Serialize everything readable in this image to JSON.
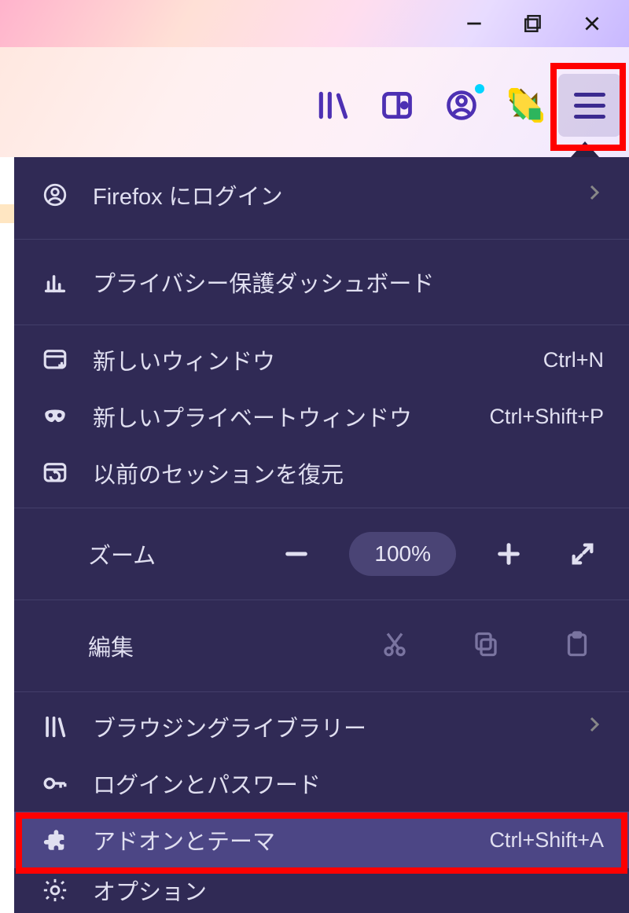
{
  "window_controls": {
    "minimize": "minimize",
    "maximize": "maximize",
    "close": "close"
  },
  "toolbar": {
    "library": "library-icon",
    "sidebar": "sidebar-icon",
    "account": "account-icon",
    "download": "download-icon",
    "menu": "menu-icon"
  },
  "menu": {
    "login": {
      "label": "Firefox にログイン"
    },
    "privacy_dashboard": {
      "label": "プライバシー保護ダッシュボード"
    },
    "new_window": {
      "label": "新しいウィンドウ",
      "shortcut": "Ctrl+N"
    },
    "new_private_window": {
      "label": "新しいプライベートウィンドウ",
      "shortcut": "Ctrl+Shift+P"
    },
    "restore_session": {
      "label": "以前のセッションを復元"
    },
    "zoom": {
      "label": "ズーム",
      "value": "100%"
    },
    "edit": {
      "label": "編集"
    },
    "library": {
      "label": "ブラウジングライブラリー"
    },
    "logins": {
      "label": "ログインとパスワード"
    },
    "addons": {
      "label": "アドオンとテーマ",
      "shortcut": "Ctrl+Shift+A"
    },
    "options": {
      "label": "オプション"
    }
  }
}
